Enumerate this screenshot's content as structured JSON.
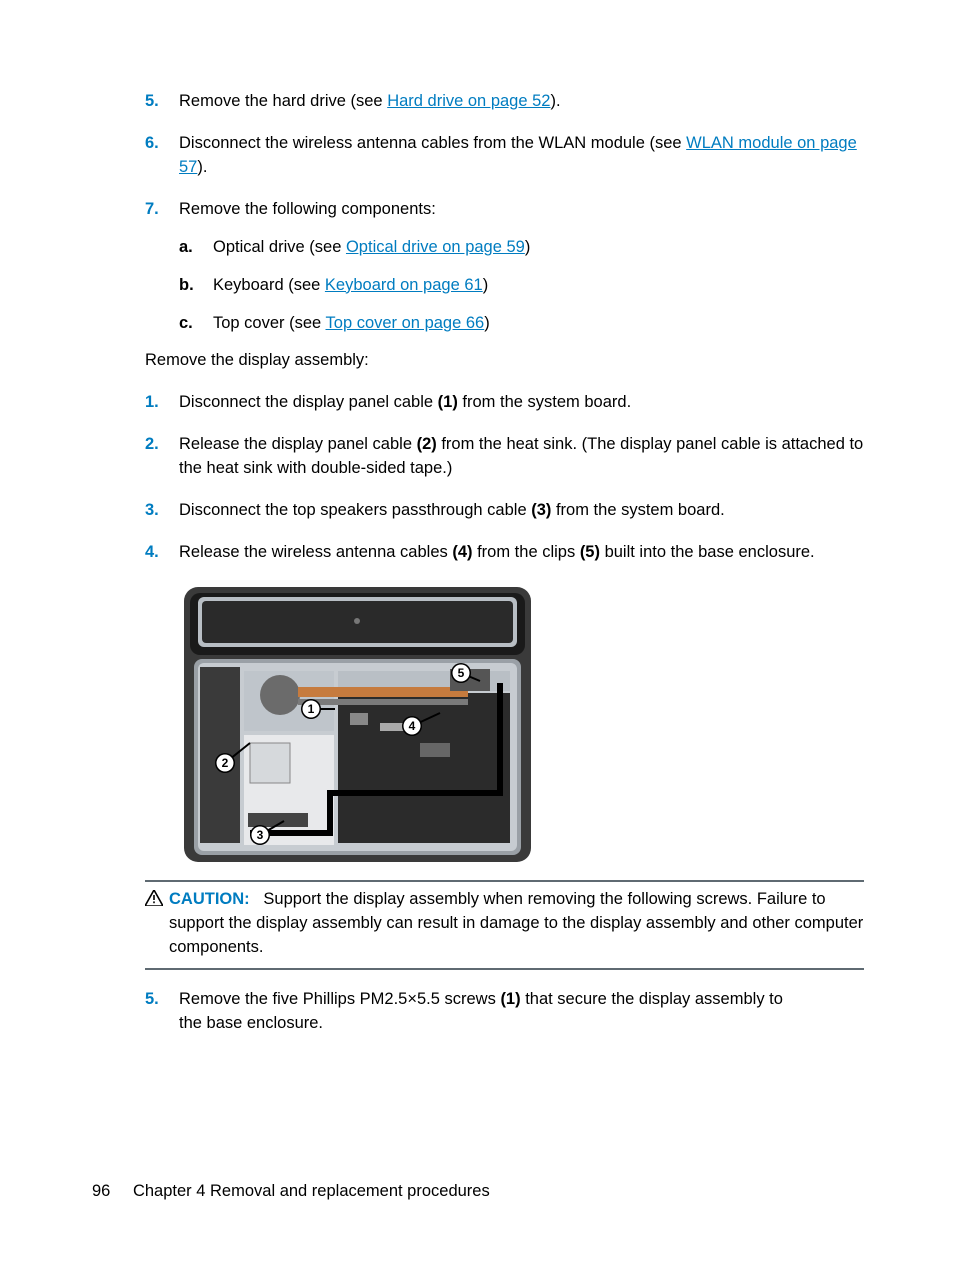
{
  "steps_top": [
    {
      "num": "5.",
      "pre": "Remove the hard drive (see ",
      "link": "Hard drive on page 52",
      "post": ")."
    },
    {
      "num": "6.",
      "pre": "Disconnect the wireless antenna cables from the WLAN module (see ",
      "link": "WLAN module on page 57",
      "post": ")."
    },
    {
      "num": "7.",
      "pre": "Remove the following components:",
      "link": "",
      "post": ""
    }
  ],
  "substeps": [
    {
      "num": "a.",
      "pre": "Optical drive (see ",
      "link": "Optical drive on page 59",
      "post": ")"
    },
    {
      "num": "b.",
      "pre": "Keyboard (see ",
      "link": "Keyboard on page 61",
      "post": ")"
    },
    {
      "num": "c.",
      "pre": "Top cover (see ",
      "link": "Top cover on page 66",
      "post": ")"
    }
  ],
  "section_intro": "Remove the display assembly:",
  "steps_mid": [
    {
      "num": "1.",
      "text_a": "Disconnect the display panel cable ",
      "b1": "(1)",
      "text_b": " from the system board.",
      "b2": "",
      "text_c": ""
    },
    {
      "num": "2.",
      "text_a": "Release the display panel cable ",
      "b1": "(2)",
      "text_b": " from the heat sink. (The display panel cable is attached to the heat sink with double-sided tape.)",
      "b2": "",
      "text_c": ""
    },
    {
      "num": "3.",
      "text_a": "Disconnect the top speakers passthrough cable ",
      "b1": "(3)",
      "text_b": " from the system board.",
      "b2": "",
      "text_c": ""
    },
    {
      "num": "4.",
      "text_a": "Release the wireless antenna cables ",
      "b1": "(4)",
      "text_b": " from the clips ",
      "b2": "(5)",
      "text_c": " built into the base enclosure."
    }
  ],
  "callouts": [
    "1",
    "2",
    "3",
    "4",
    "5"
  ],
  "caution": {
    "label": "CAUTION:",
    "text": "Support the display assembly when removing the following screws. Failure to support the display assembly can result in damage to the display assembly and other computer components."
  },
  "step_after": {
    "num": "5.",
    "text_a": "Remove the five Phillips PM2.5×5.5 screws ",
    "b1": "(1)",
    "text_b": " that secure the display assembly to the base enclosure."
  },
  "footer": {
    "page_no": "96",
    "chapter": "Chapter 4   Removal and replacement procedures"
  }
}
